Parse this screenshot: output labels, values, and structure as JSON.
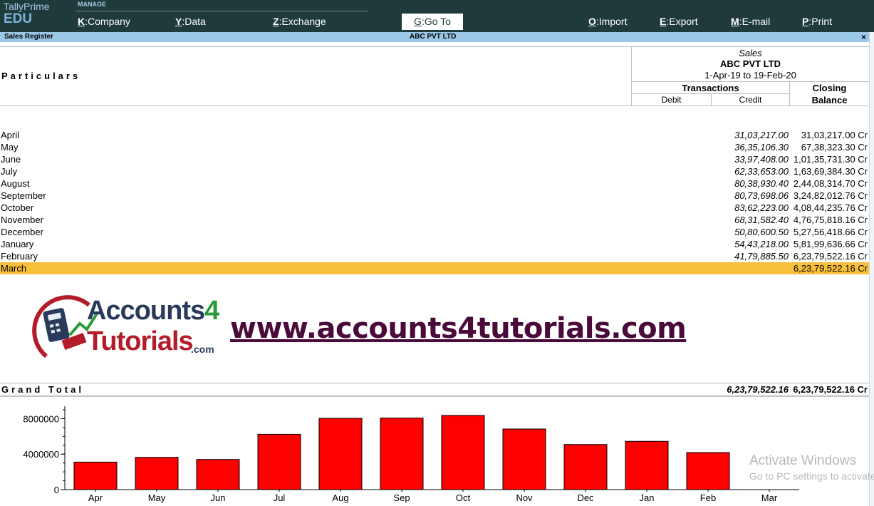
{
  "app": {
    "name": "TallyPrime",
    "edition": "EDU"
  },
  "menu": {
    "section": "MANAGE",
    "items": [
      {
        "key": "K",
        "label": "Company"
      },
      {
        "key": "Y",
        "label": "Data"
      },
      {
        "key": "Z",
        "label": "Exchange"
      },
      {
        "key": "G",
        "label": "Go To"
      },
      {
        "key": "O",
        "label": "Import"
      },
      {
        "key": "E",
        "label": "Export"
      },
      {
        "key": "M",
        "label": "E-mail"
      },
      {
        "key": "P",
        "label": "Print"
      }
    ]
  },
  "titlebar": {
    "report": "Sales Register",
    "company": "ABC PVT LTD",
    "close": "×"
  },
  "header": {
    "particulars": "Particulars",
    "column_title": "Sales",
    "company": "ABC PVT LTD",
    "period": "1-Apr-19 to 19-Feb-20",
    "transactions": "Transactions",
    "debit": "Debit",
    "credit": "Credit",
    "closing_line1": "Closing",
    "closing_line2": "Balance"
  },
  "rows": [
    {
      "month": "April",
      "credit": "31,03,217.00",
      "closing": "31,03,217.00 Cr"
    },
    {
      "month": "May",
      "credit": "36,35,106.30",
      "closing": "67,38,323.30 Cr"
    },
    {
      "month": "June",
      "credit": "33,97,408.00",
      "closing": "1,01,35,731.30 Cr"
    },
    {
      "month": "July",
      "credit": "62,33,653.00",
      "closing": "1,63,69,384.30 Cr"
    },
    {
      "month": "August",
      "credit": "80,38,930.40",
      "closing": "2,44,08,314.70 Cr"
    },
    {
      "month": "September",
      "credit": "80,73,698.06",
      "closing": "3,24,82,012.76 Cr"
    },
    {
      "month": "October",
      "credit": "83,62,223.00",
      "closing": "4,08,44,235.76 Cr"
    },
    {
      "month": "November",
      "credit": "68,31,582.40",
      "closing": "4,76,75,818.16 Cr"
    },
    {
      "month": "December",
      "credit": "50,80,600.50",
      "closing": "5,27,56,418.66 Cr"
    },
    {
      "month": "January",
      "credit": "54,43,218.00",
      "closing": "5,81,99,636.66 Cr"
    },
    {
      "month": "February",
      "credit": "41,79,885.50",
      "closing": "6,23,79,522.16 Cr"
    },
    {
      "month": "March",
      "credit": "",
      "closing": "6,23,79,522.16 Cr",
      "selected": true
    }
  ],
  "grand_total": {
    "label": "Grand Total",
    "credit": "6,23,79,522.16",
    "closing": "6,23,79,522.16 Cr"
  },
  "watermark": {
    "logo_line1_a": "Accounts",
    "logo_line1_b": "4",
    "logo_line2": "Tutorials",
    "logo_suffix": ".com",
    "website": "www.accounts4tutorials.com"
  },
  "activation": {
    "title": "Activate Windows",
    "subtitle": "Go to PC settings to activate Windows."
  },
  "colors": {
    "topbar": "#1e3a3a",
    "titlebar": "#9cc8e8",
    "selected_row": "#f7bf3a",
    "bar_fill": "#ff0000"
  },
  "chart_data": {
    "type": "bar",
    "categories": [
      "Apr",
      "May",
      "Jun",
      "Jul",
      "Aug",
      "Sep",
      "Oct",
      "Nov",
      "Dec",
      "Jan",
      "Feb",
      "Mar"
    ],
    "values": [
      3103217.0,
      3635106.3,
      3397408.0,
      6233653.0,
      8038930.4,
      8073698.06,
      8362223.0,
      6831582.4,
      5080600.5,
      5443218.0,
      4179885.5,
      0
    ],
    "yticks": [
      0,
      4000000,
      8000000
    ],
    "ytick_labels": [
      "0",
      "4000000",
      "8000000"
    ],
    "ylim": [
      0,
      9400000
    ],
    "title": "",
    "xlabel": "",
    "ylabel": ""
  }
}
